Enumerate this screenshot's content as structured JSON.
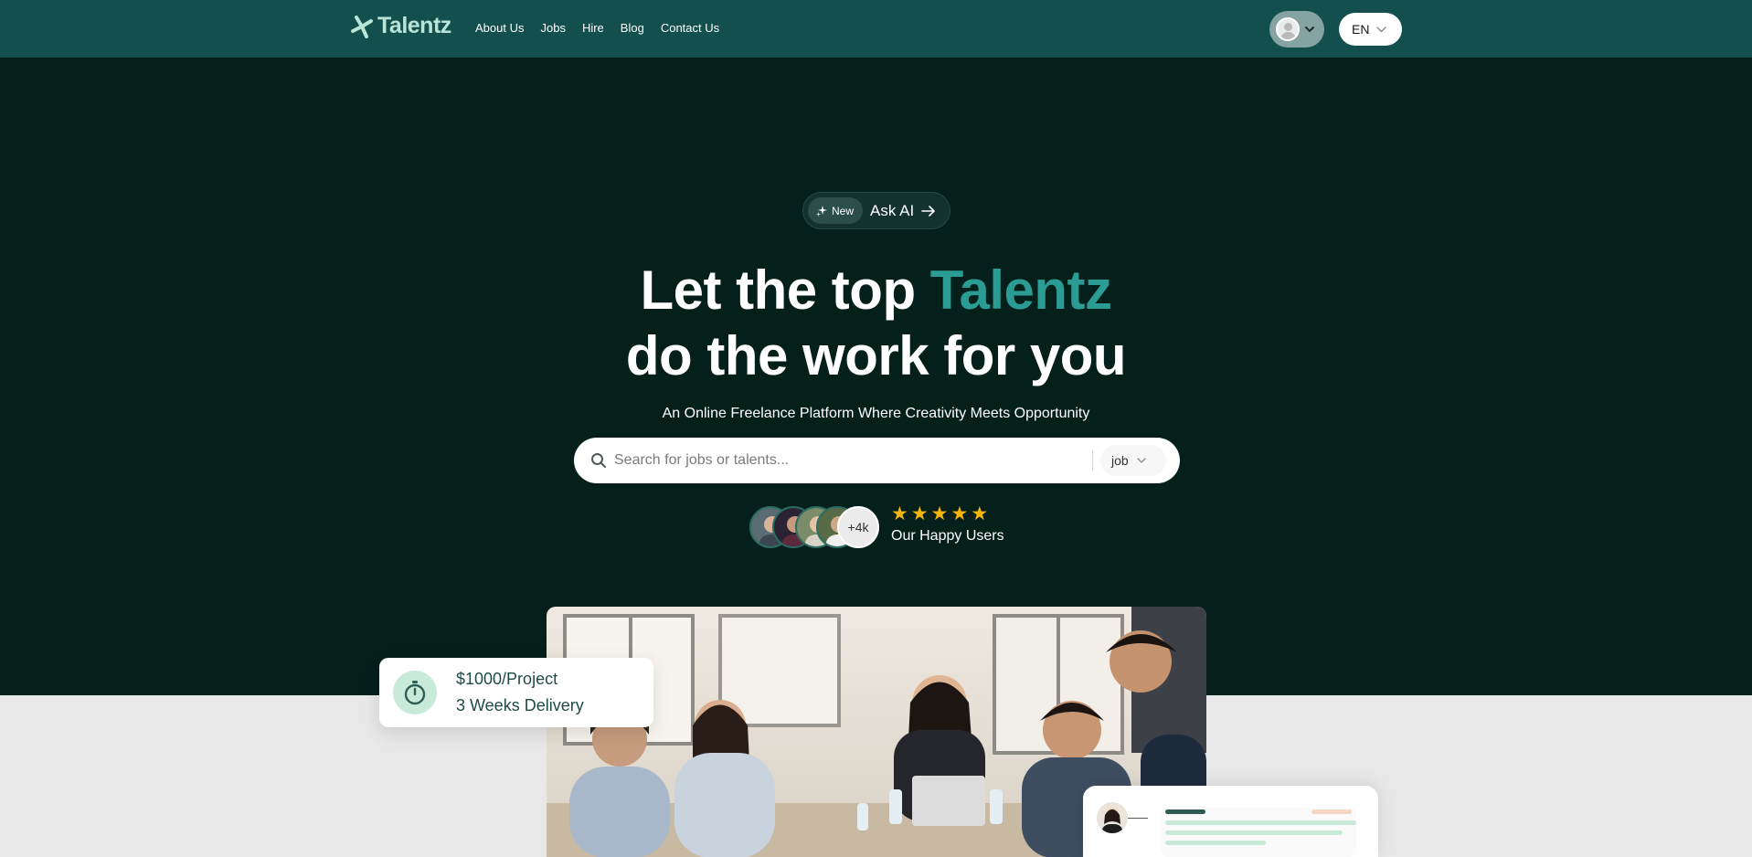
{
  "brand": {
    "name": "Talentz",
    "accent": "#2b9c94",
    "nav_bg": "#124f4d",
    "hero_bg": "#051f1b"
  },
  "nav": {
    "links": [
      "About Us",
      "Jobs",
      "Hire",
      "Blog",
      "Contact Us"
    ],
    "language": "EN"
  },
  "hero": {
    "badge": {
      "label": "New",
      "icon": "sparkles-icon"
    },
    "ask_ai": "Ask AI",
    "headline": {
      "line1_prefix": "Let the top",
      "line1_accent": "Talentz",
      "line2": "do the work for you"
    },
    "subtitle": "An Online Freelance Platform Where Creativity Meets Opportunity",
    "search": {
      "placeholder": "Search for jobs or talents...",
      "type_value": "job"
    },
    "users": {
      "more_count": "+4k",
      "rating_stars": 5,
      "label": "Our Happy Users"
    }
  },
  "floating_card": {
    "price": "$1000/Project",
    "delivery": "3 Weeks Delivery"
  }
}
